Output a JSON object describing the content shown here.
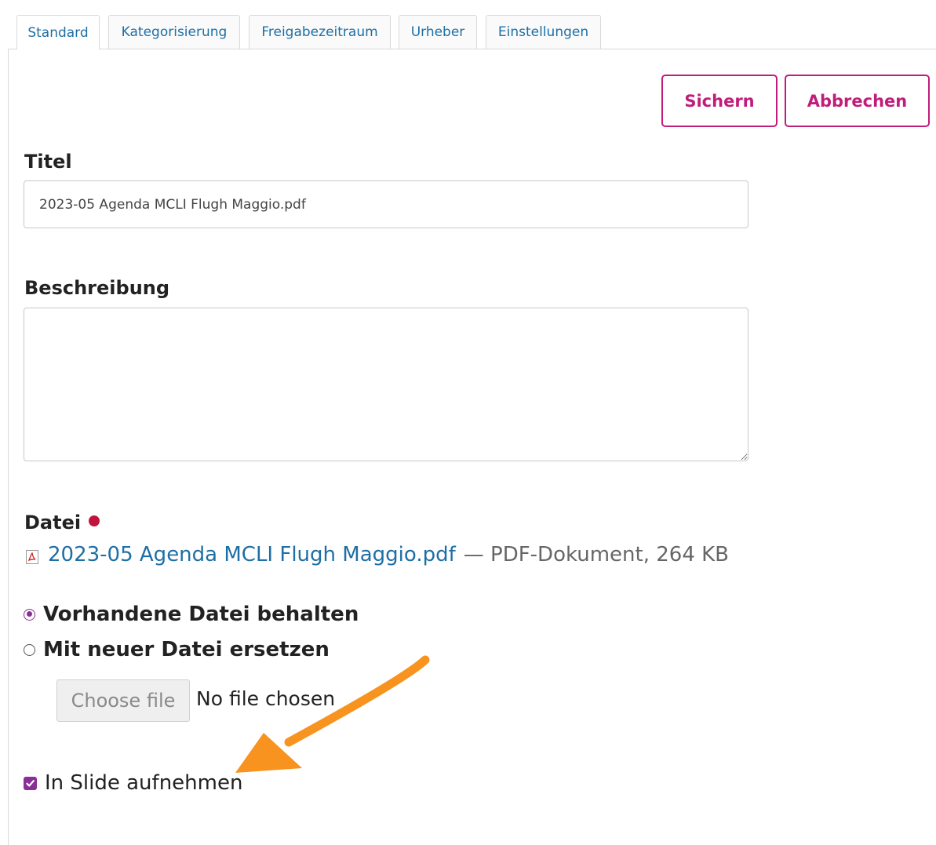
{
  "tabs": [
    {
      "label": "Standard",
      "active": true
    },
    {
      "label": "Kategorisierung",
      "active": false
    },
    {
      "label": "Freigabezeitraum",
      "active": false
    },
    {
      "label": "Urheber",
      "active": false
    },
    {
      "label": "Einstellungen",
      "active": false
    }
  ],
  "actions": {
    "save_label": "Sichern",
    "cancel_label": "Abbrechen"
  },
  "form": {
    "title_label": "Titel",
    "title_value": "2023-05 Agenda MCLI Flugh Maggio.pdf",
    "description_label": "Beschreibung",
    "description_value": "",
    "file_label": "Datei",
    "file_name": "2023-05 Agenda MCLI Flugh Maggio.pdf",
    "file_meta": "— PDF-Dokument, 264 KB",
    "keep_file_label": "Vorhandene Datei behalten",
    "replace_file_label": "Mit neuer Datei ersetzen",
    "selected_file_option": "keep",
    "choose_file_label": "Choose file",
    "no_file_text": "No file chosen",
    "slide_label": "In Slide aufnehmen",
    "slide_checked": true
  },
  "colors": {
    "accent_magenta": "#c01d7a",
    "link_blue": "#1d6fa5",
    "required_red": "#c0143c",
    "control_purple": "#8a2f97",
    "annotation_orange": "#f7931e"
  },
  "icons": {
    "file_type": "pdf-icon",
    "required": "required-dot-icon",
    "annotation": "arrow-annotation-icon"
  }
}
